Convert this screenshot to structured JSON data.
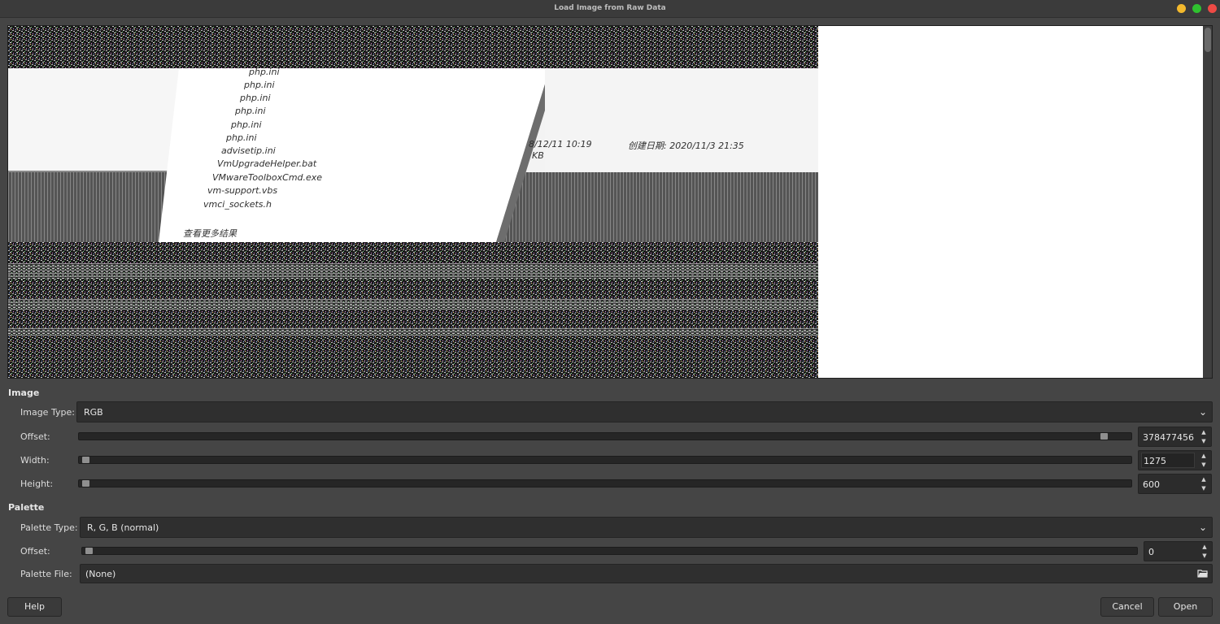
{
  "window": {
    "title": "Load Image from Raw Data"
  },
  "preview": {
    "files": [
      "php.ini",
      "php.ini",
      "php.ini",
      "php.ini",
      "php.ini",
      "php.ini",
      "advisetip.ini",
      "VmUpgradeHelper.bat",
      "VMwareToolboxCmd.exe",
      "vm-support.vbs",
      "vmci_sockets.h"
    ],
    "search_more": "查看更多结果",
    "modified": "8/12/11 10:19",
    "created": "创建日期: 2020/11/3 21:35",
    "size_unit": "KB"
  },
  "image_section": {
    "heading": "Image",
    "image_type_label": "Image Type:",
    "image_type_value": "RGB",
    "offset_label": "Offset:",
    "offset_value": "378477456",
    "offset_level": 0.975,
    "width_label": "Width:",
    "width_value": "1275",
    "width_level": 0.0,
    "height_label": "Height:",
    "height_value": "600",
    "height_level": 0.0
  },
  "palette_section": {
    "heading": "Palette",
    "palette_type_label": "Palette Type:",
    "palette_type_value": "R, G, B (normal)",
    "offset_label": "Offset:",
    "offset_value": "0",
    "offset_level": 0.0,
    "palette_file_label": "Palette File:",
    "palette_file_value": "(None)"
  },
  "buttons": {
    "help": "Help",
    "cancel": "Cancel",
    "open": "Open"
  },
  "icons": {
    "dropdown": "chevron-down-icon",
    "spin_up": "triangle-up-icon",
    "spin_down": "triangle-down-icon",
    "file_picker": "open-file-icon"
  }
}
